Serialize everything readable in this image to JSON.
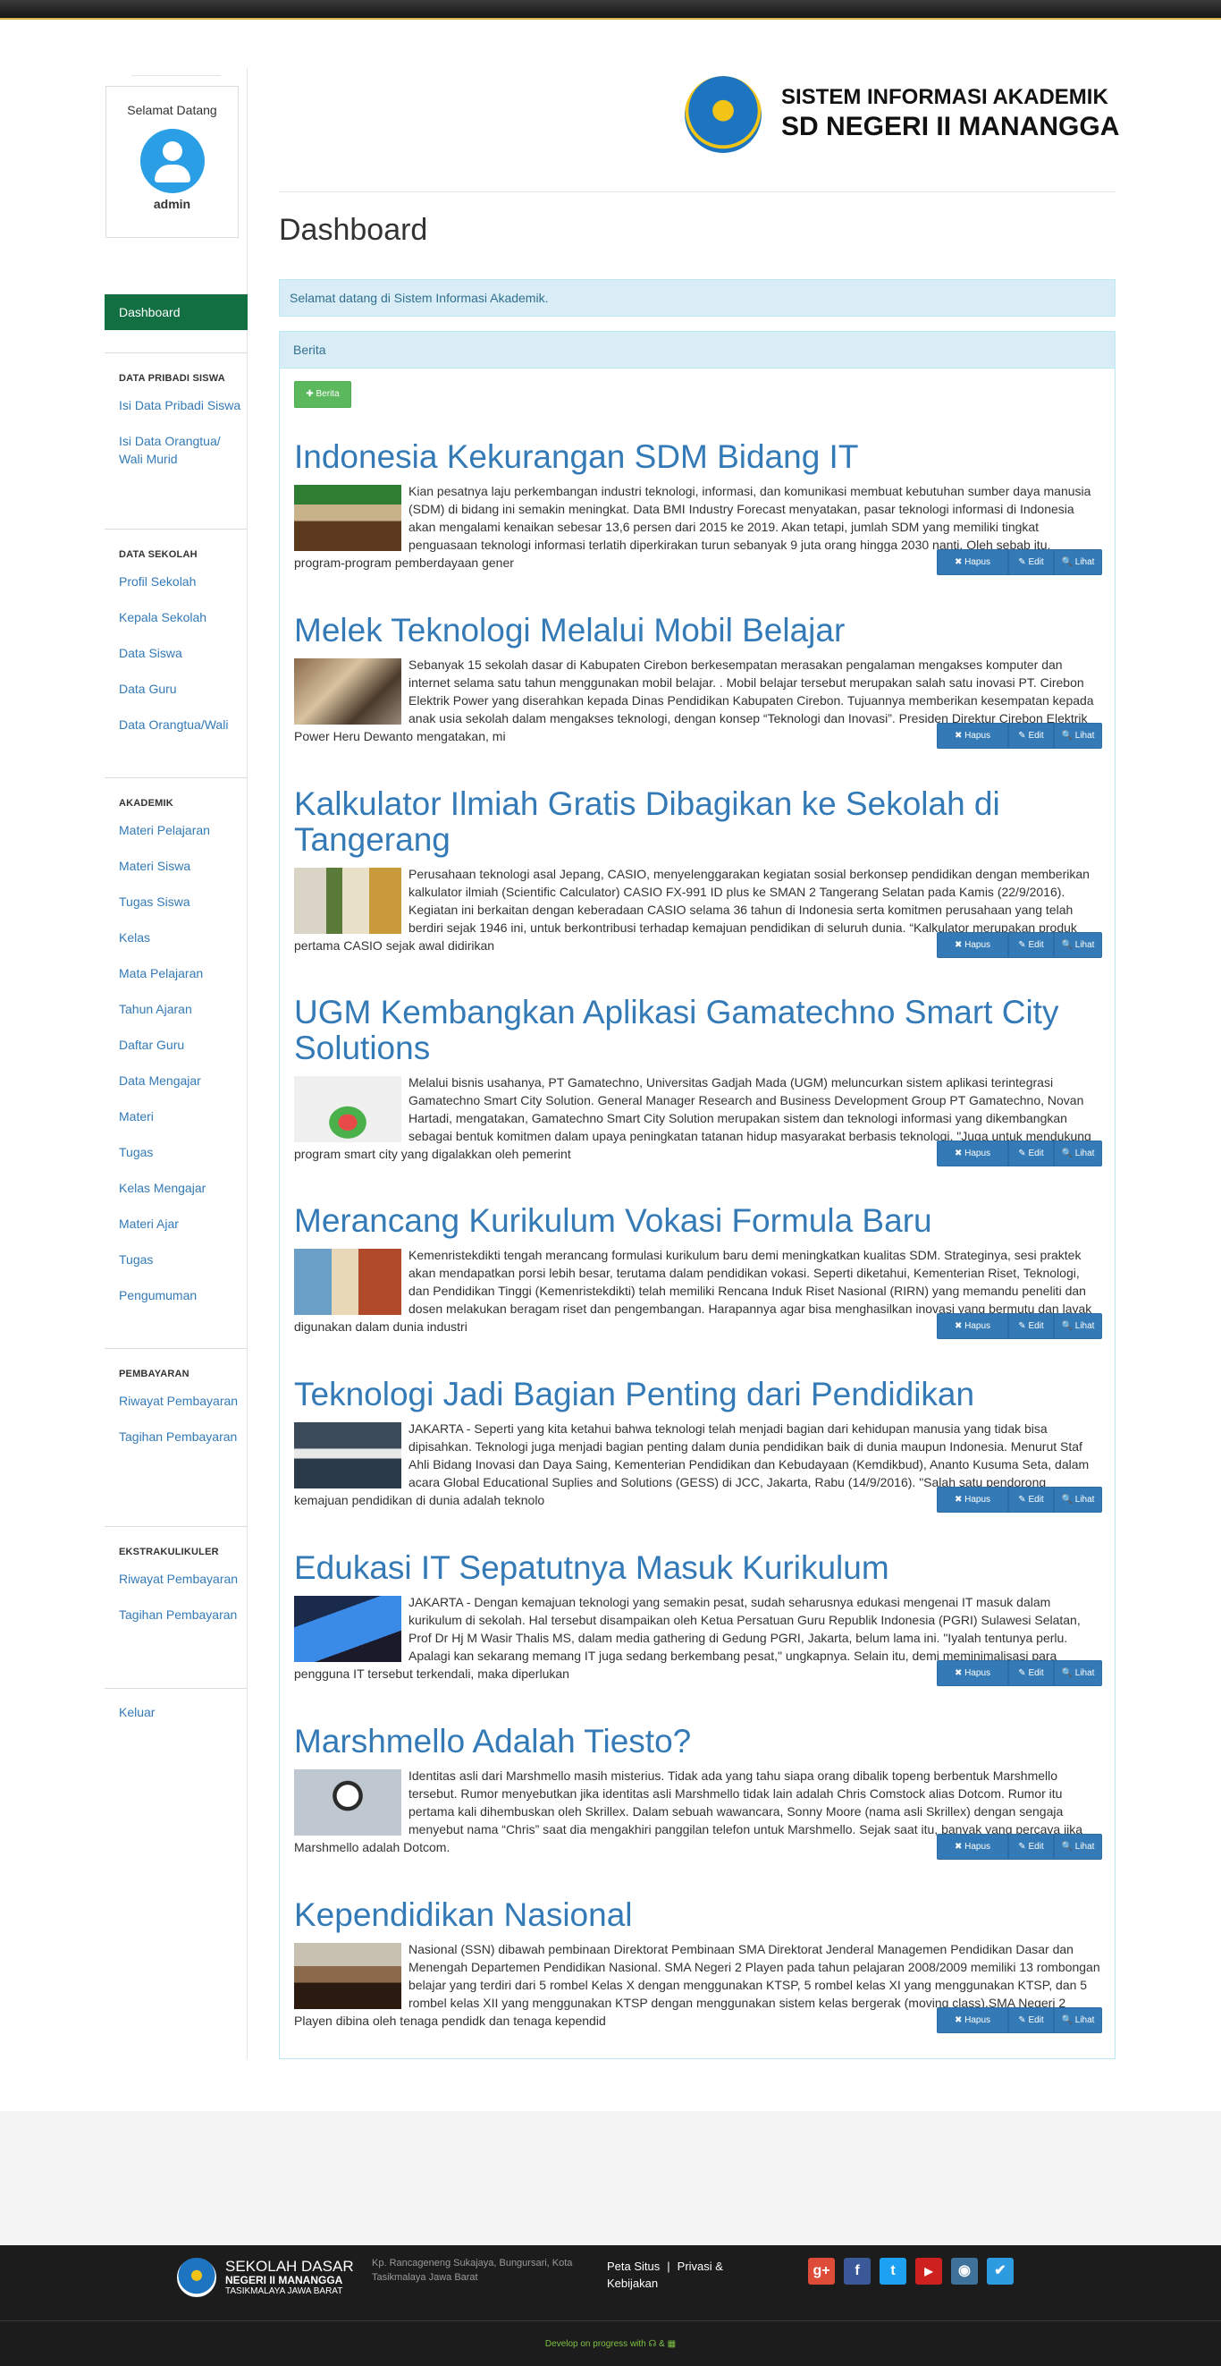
{
  "sidebar": {
    "welcome": "Selamat Datang",
    "username": "admin",
    "active_item": "Dashboard",
    "groups": [
      {
        "heading": "DATA PRIBADI SISWA",
        "items": [
          "Isi Data Pribadi Siswa",
          "Isi Data Orangtua/ Wali Murid"
        ]
      },
      {
        "heading": "DATA SEKOLAH",
        "items": [
          "Profil Sekolah",
          "Kepala Sekolah",
          "Data Siswa",
          "Data Guru",
          "Data Orangtua/Wali"
        ]
      },
      {
        "heading": "AKADEMIK",
        "items": [
          "Materi Pelajaran",
          "Materi Siswa",
          "Tugas Siswa",
          "Kelas",
          "Mata Pelajaran",
          "Tahun Ajaran",
          "Daftar Guru",
          "Data Mengajar",
          "Materi",
          "Tugas",
          "Kelas Mengajar",
          "Materi Ajar",
          "Tugas",
          "Pengumuman"
        ]
      },
      {
        "heading": "PEMBAYARAN",
        "items": [
          "Riwayat Pembayaran",
          "Tagihan Pembayaran"
        ]
      },
      {
        "heading": "EKSTRAKULIKULER",
        "items": [
          "Riwayat Pembayaran",
          "Tagihan Pembayaran"
        ]
      }
    ],
    "logout": "Keluar"
  },
  "header": {
    "logo_line1": "SISTEM INFORMASI AKADEMIK",
    "logo_line2": "SD NEGERI II MANANGGA"
  },
  "main": {
    "title": "Dashboard",
    "alert": "Selamat datang di Sistem Informasi Akademik.",
    "panel_heading": "Berita",
    "add_button": "✚ Berita",
    "actions": {
      "delete": "✖ Hapus",
      "edit": "✎ Edit",
      "view": "🔍 Lihat"
    },
    "news": [
      {
        "title": "Indonesia Kekurangan SDM Bidang IT",
        "excerpt": "Kian pesatnya laju perkembangan industri teknologi, informasi, dan komunikasi membuat kebutuhan sumber daya manusia (SDM) di bidang ini semakin meningkat. Data BMI Industry Forecast menyatakan, pasar teknologi informasi di Indonesia akan mengalami kenaikan sebesar 13,6 persen dari 2015 ke 2019. Akan tetapi, jumlah SDM yang memiliki tingkat penguasaan teknologi informasi terlatih diperkirakan turun sebanyak 9 juta orang hingga 2030 nanti. Oleh sebab itu, program-program pemberdayaan gener"
      },
      {
        "title": "Melek Teknologi Melalui Mobil Belajar",
        "excerpt": "Sebanyak 15 sekolah dasar di Kabupaten Cirebon berkesempatan merasakan pengalaman mengakses komputer dan internet selama satu tahun menggunakan mobil belajar. . Mobil belajar tersebut merupakan salah satu inovasi PT. Cirebon Elektrik Power yang diserahkan kepada Dinas Pendidikan Kabupaten Cirebon. Tujuannya memberikan kesempatan kepada anak usia sekolah dalam mengakses teknologi, dengan konsep “Teknologi dan Inovasi”. Presiden Direktur Cirebon Elektrik Power Heru Dewanto mengatakan, mi"
      },
      {
        "title": "Kalkulator Ilmiah Gratis Dibagikan ke Sekolah di Tangerang",
        "excerpt": "Perusahaan teknologi asal Jepang, CASIO, menyelenggarakan kegiatan sosial berkonsep pendidikan dengan memberikan kalkulator ilmiah (Scientific Calculator) CASIO FX-991 ID plus ke SMAN 2 Tangerang Selatan pada Kamis (22/9/2016). Kegiatan ini berkaitan dengan keberadaan CASIO selama 36 tahun di Indonesia serta komitmen perusahaan yang telah berdiri sejak 1946 ini, untuk berkontribusi terhadap kemajuan pendidikan di seluruh dunia. “Kalkulator merupakan produk pertama CASIO sejak awal didirikan"
      },
      {
        "title": "UGM Kembangkan Aplikasi Gamatechno Smart City Solutions",
        "excerpt": "Melalui bisnis usahanya, PT Gamatechno, Universitas Gadjah Mada (UGM) meluncurkan sistem aplikasi terintegrasi Gamatechno Smart City Solution. General Manager Research and Business Development Group PT Gamatechno, Novan Hartadi, mengatakan, Gamatechno Smart City Solution merupakan sistem dan teknologi informasi yang dikembangkan sebagai bentuk komitmen dalam upaya peningkatan tatanan hidup masyarakat berbasis teknologi. \"Juga untuk mendukung program smart city yang digalakkan oleh pemerint"
      },
      {
        "title": "Merancang Kurikulum Vokasi Formula Baru",
        "excerpt": "Kemenristekdikti tengah merancang formulasi kurikulum baru demi meningkatkan kualitas SDM. Strateginya, sesi praktek akan mendapatkan porsi lebih besar, terutama dalam pendidikan vokasi. Seperti diketahui, Kementerian Riset, Teknologi, dan Pendidikan Tinggi (Kemenristekdikti) telah memiliki Rencana Induk Riset Nasional (RIRN) yang memandu peneliti dan dosen melakukan beragam riset dan pengembangan. Harapannya agar bisa menghasilkan inovasi yang bermutu dan layak digunakan dalam dunia industri"
      },
      {
        "title": "Teknologi Jadi Bagian Penting dari Pendidikan",
        "excerpt": "JAKARTA - Seperti yang kita ketahui bahwa teknologi telah menjadi bagian dari kehidupan manusia yang tidak bisa dipisahkan. Teknologi juga menjadi bagian penting dalam dunia pendidikan baik di dunia maupun Indonesia. Menurut Staf Ahli Bidang Inovasi dan Daya Saing, Kementerian Pendidikan dan Kebudayaan (Kemdikbud), Ananto Kusuma Seta, dalam acara Global Educational Suplies and Solutions (GESS) di JCC, Jakarta, Rabu (14/9/2016). \"Salah satu pendorong kemajuan pendidikan di dunia adalah teknolo"
      },
      {
        "title": "Edukasi IT Sepatutnya Masuk Kurikulum",
        "excerpt": "JAKARTA - Dengan kemajuan teknologi yang semakin pesat, sudah seharusnya edukasi mengenai IT masuk dalam kurikulum di sekolah. Hal tersebut disampaikan oleh Ketua Persatuan Guru Republik Indonesia (PGRI) Sulawesi Selatan, Prof Dr Hj M Wasir Thalis MS, dalam media gathering di Gedung PGRI, Jakarta, belum lama ini. \"Iyalah tentunya perlu. Apalagi kan sekarang memang IT juga sedang berkembang pesat,\" ungkapnya. Selain itu, demi meminimalisasi para pengguna IT tersebut terkendali, maka diperlukan"
      },
      {
        "title": "Marshmello Adalah Tiesto?",
        "excerpt": "Identitas asli dari Marshmello masih misterius. Tidak ada yang tahu siapa orang dibalik topeng berbentuk Marshmello tersebut. Rumor menyebutkan jika identitas asli Marshmello tidak lain adalah Chris Comstock alias Dotcom. Rumor itu pertama kali dihembuskan oleh Skrillex. Dalam sebuah wawancara, Sonny Moore (nama asli Skrillex) dengan sengaja menyebut nama “Chris” saat dia mengakhiri panggilan telefon untuk Marshmello. Sejak saat itu, banyak yang percaya jika Marshmello adalah Dotcom."
      },
      {
        "title": "Kependidikan Nasional",
        "excerpt": "Nasional (SSN) dibawah pembinaan Direktorat Pembinaan SMA Direktorat Jenderal Managemen Pendidikan Dasar dan Menengah Departemen Pendidikan Nasional. SMA Negeri 2 Playen pada tahun pelajaran 2008/2009 memiliki 13 rombongan belajar yang terdiri dari 5 rombel Kelas X dengan menggunakan KTSP, 5 rombel kelas XI yang menggunakan KTSP, dan 5 rombel kelas XII yang menggunakan KTSP dengan menggunakan sistem kelas bergerak (moving class).SMA Negeri 2 Playen dibina oleh tenaga pendidk dan tenaga kependid"
      }
    ]
  },
  "footer": {
    "school_line1": "SEKOLAH DASAR",
    "school_line2": "NEGERI II MANANGGA",
    "school_line3": "TASIKMALAYA JAWA BARAT",
    "address": "Kp. Rancageneng Sukajaya, Bungursari, Kota Tasikmalaya Jawa Barat",
    "link_sitemap": "Peta Situs",
    "link_privacy": "Privasi & Kebijakan",
    "socials": [
      {
        "name": "google-plus-icon",
        "glyph": "g+",
        "color": "#dd4b39"
      },
      {
        "name": "facebook-icon",
        "glyph": "f",
        "color": "#3b5998"
      },
      {
        "name": "twitter-icon",
        "glyph": "t",
        "color": "#1da1f2"
      },
      {
        "name": "youtube-icon",
        "glyph": "▶",
        "color": "#cd201f"
      },
      {
        "name": "instagram-icon",
        "glyph": "◉",
        "color": "#3f729b"
      },
      {
        "name": "delicious-icon",
        "glyph": "✔",
        "color": "#2c9be0"
      }
    ],
    "credit": "Develop on progress with ☊ & ▦"
  }
}
